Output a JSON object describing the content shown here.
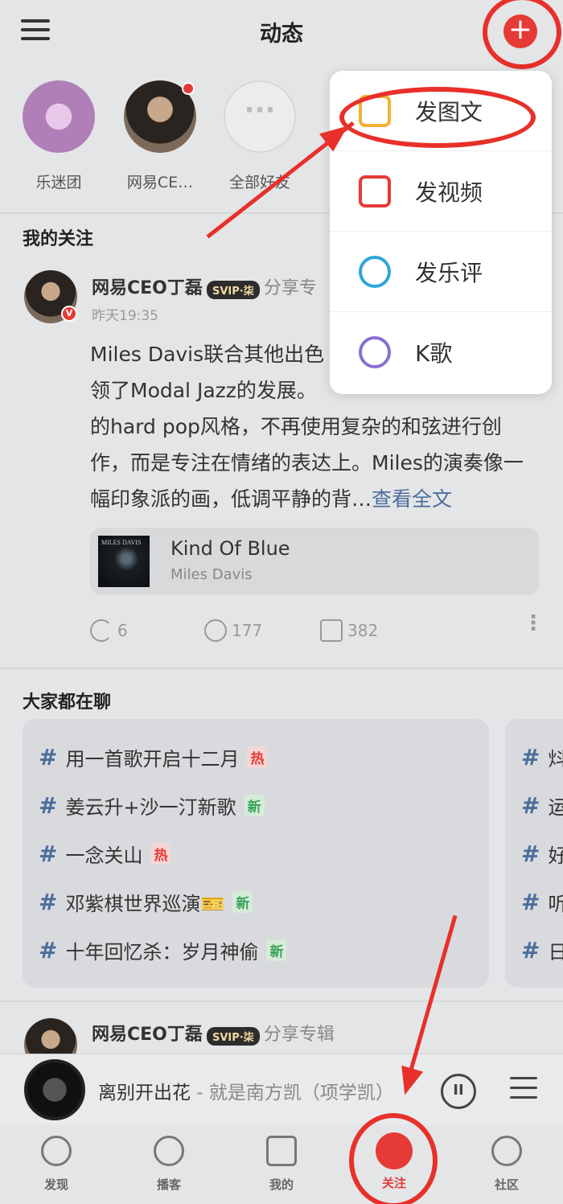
{
  "header": {
    "title": "动态"
  },
  "stories": [
    {
      "label": "乐迷团"
    },
    {
      "label": "网易CE…"
    },
    {
      "label": "全部好友"
    }
  ],
  "my_follow": {
    "title": "我的关注"
  },
  "post": {
    "username": "网易CEO丁磊",
    "vip_badge": "SVIP·柒",
    "action": "分享专",
    "time": "昨天19:35",
    "text": "Miles Davis联合其他出色的音乐家引领了Modal Jazz的发展。他摈弃了之前流行的hard pop风格，不再使用复杂的和弦进行创作，而是专注在情绪的表达上。Miles的演奏像一幅印象派的画，低调平静的背…",
    "text_lines": [
      "Miles Davis联合其他出色",
      "领了Modal Jazz的发展。",
      "的hard pop风格，不再使用复杂的和弦进行创",
      "作，而是专注在情绪的表达上。Miles的演奏像一",
      "幅印象派的画，低调平静的背…"
    ],
    "read_more": "查看全文",
    "album": {
      "title": "Kind Of Blue",
      "artist": "Miles Davis",
      "cover_text": "MILES DAVIS"
    },
    "stats": {
      "share": "6",
      "comment": "177",
      "like": "382"
    }
  },
  "topics": {
    "title": "大家都在聊",
    "items": [
      {
        "text": "用一首歌开启十二月",
        "tag": "热"
      },
      {
        "text": "姜云升+沙一汀新歌",
        "tag": "新"
      },
      {
        "text": "一念关山",
        "tag": "热"
      },
      {
        "text": "邓紫棋世界巡演🎫",
        "tag": "新"
      },
      {
        "text": "十年回忆杀：岁月神偷",
        "tag": "新"
      }
    ],
    "second_col": [
      "炓",
      "运",
      "好",
      "听",
      "日"
    ]
  },
  "post2": {
    "username": "网易CEO丁磊",
    "vip_badge": "SVIP·柒",
    "action": "分享专辑"
  },
  "player": {
    "song": "离别开出花",
    "separator": " - ",
    "artist": "就是南方凯（项学凯）",
    "pause_label": "II"
  },
  "tabs": [
    {
      "label": "发现",
      "icon": "discover-icon"
    },
    {
      "label": "播客",
      "icon": "podcast-icon"
    },
    {
      "label": "我的",
      "icon": "music-note-icon"
    },
    {
      "label": "关注",
      "icon": "follow-icon"
    },
    {
      "label": "社区",
      "icon": "community-icon"
    }
  ],
  "dropdown": {
    "items": [
      {
        "label": "发图文",
        "icon": "image-text-icon",
        "color": "#f2b233"
      },
      {
        "label": "发视频",
        "icon": "video-icon",
        "color": "#e63a36"
      },
      {
        "label": "发乐评",
        "icon": "comment-icon",
        "color": "#2fa6d8"
      },
      {
        "label": "K歌",
        "icon": "karaoke-mic-icon",
        "color": "#8a6fd1"
      }
    ]
  },
  "colors": {
    "accent": "#e63a36",
    "annotation": "#e8302a",
    "link": "#4a6d9c"
  }
}
